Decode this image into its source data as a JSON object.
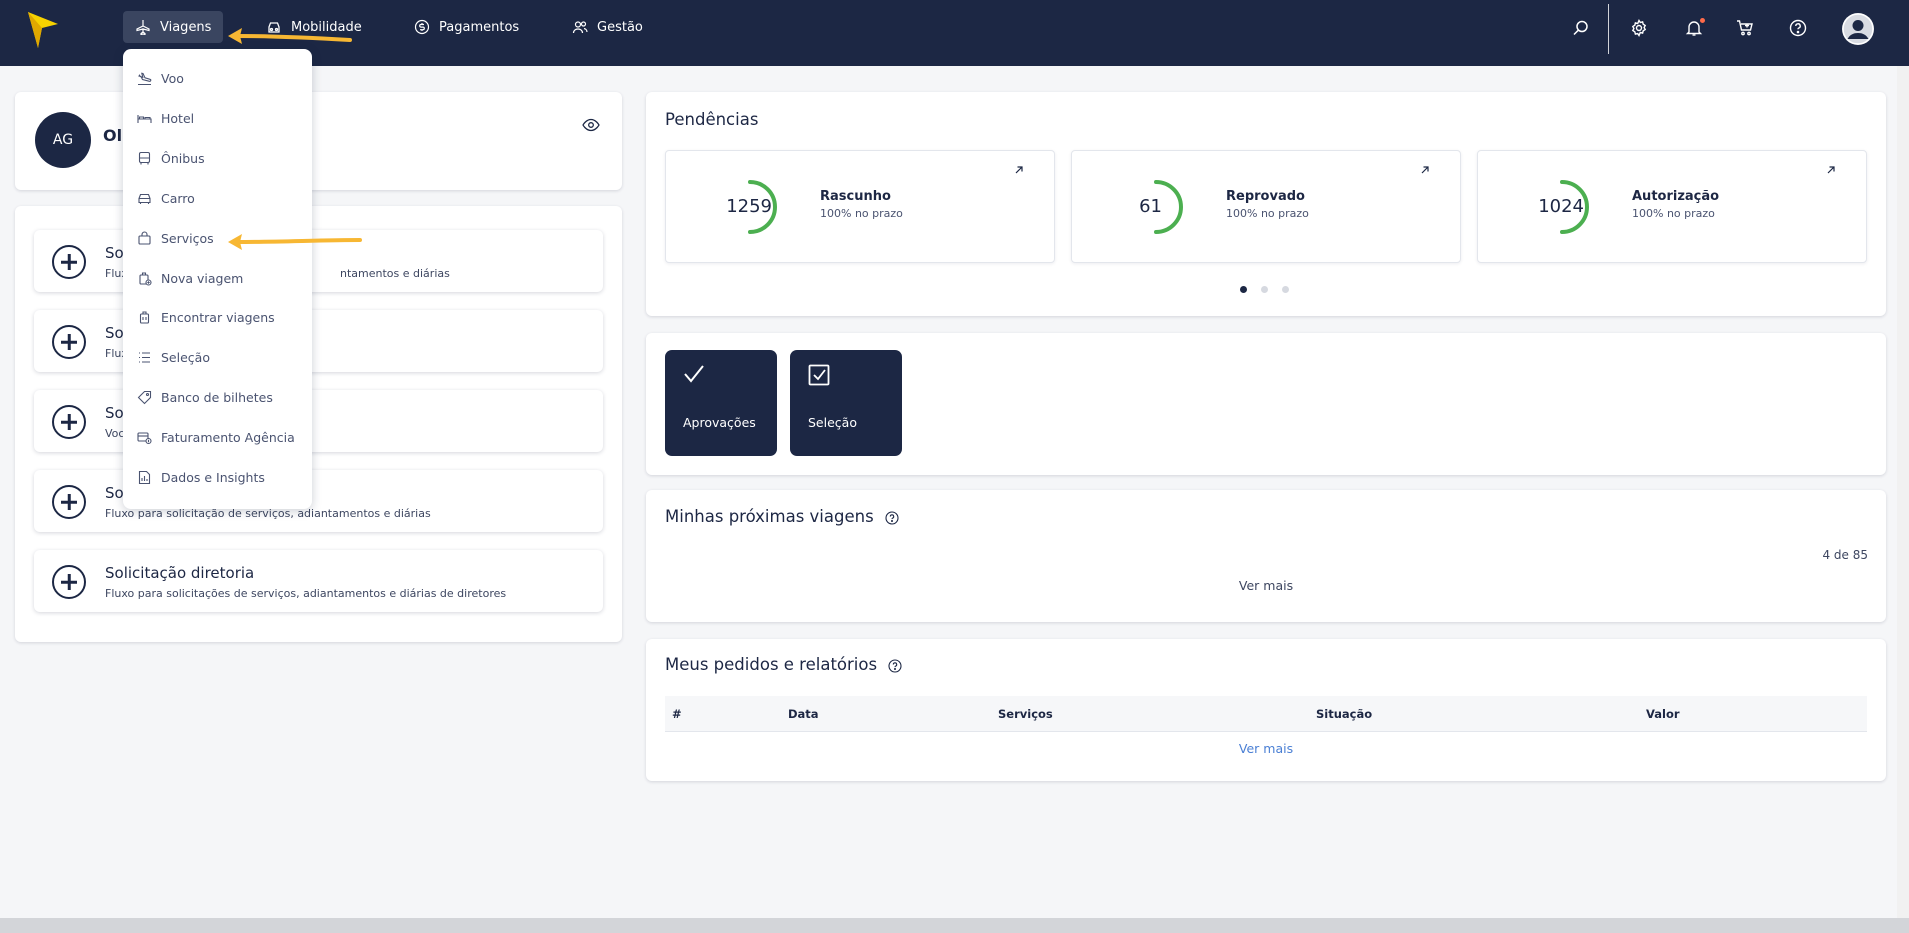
{
  "nav": {
    "items": [
      {
        "label": "Viagens",
        "icon": "plane-icon",
        "active": true
      },
      {
        "label": "Mobilidade",
        "icon": "car-icon"
      },
      {
        "label": "Pagamentos",
        "icon": "dollar-icon"
      },
      {
        "label": "Gestão",
        "icon": "users-icon"
      }
    ],
    "right_icons": [
      "search-icon",
      "gear-icon",
      "bell-icon",
      "cart-icon",
      "help-icon",
      "user-avatar"
    ]
  },
  "dropdown": {
    "items": [
      {
        "label": "Voo",
        "icon": "plane-landing-icon"
      },
      {
        "label": "Hotel",
        "icon": "bed-icon"
      },
      {
        "label": "Ônibus",
        "icon": "bus-icon"
      },
      {
        "label": "Carro",
        "icon": "car-icon"
      },
      {
        "label": "Serviços",
        "icon": "bag-icon"
      },
      {
        "label": "Nova viagem",
        "icon": "luggage-plus-icon"
      },
      {
        "label": "Encontrar viagens",
        "icon": "luggage-icon"
      },
      {
        "label": "Seleção",
        "icon": "list-icon"
      },
      {
        "label": "Banco de bilhetes",
        "icon": "ticket-icon"
      },
      {
        "label": "Faturamento Agência",
        "icon": "invoice-icon"
      },
      {
        "label": "Dados e Insights",
        "icon": "report-icon"
      }
    ]
  },
  "profile": {
    "initials": "AG",
    "greeting": "Ol"
  },
  "requests": [
    {
      "title": "So",
      "desc_left": "Flux",
      "desc_right": "ntamentos e diárias"
    },
    {
      "title": "So",
      "desc_left": "Flux",
      "desc_right": ""
    },
    {
      "title": "So",
      "desc_left": "Voc",
      "desc_right": ""
    },
    {
      "title": "So",
      "desc_left": "Fluxo para solicitação de serviços, adiantamentos e diárias",
      "desc_right": ""
    },
    {
      "title": "Solicitação diretoria",
      "desc_left": "Fluxo para solicitações de serviços, adiantamentos e diárias de diretores",
      "desc_right": ""
    }
  ],
  "pendencias": {
    "title": "Pendências",
    "cards": [
      {
        "value": "1259",
        "label": "Rascunho",
        "sub": "100% no prazo"
      },
      {
        "value": "61",
        "label": "Reprovado",
        "sub": "100% no prazo"
      },
      {
        "value": "1024",
        "label": "Autorização",
        "sub": "100% no prazo"
      }
    ]
  },
  "actions": [
    {
      "label": "Aprovações",
      "icon": "check-icon"
    },
    {
      "label": "Seleção",
      "icon": "checkbox-icon"
    }
  ],
  "trips": {
    "title": "Minhas próximas viagens",
    "count": "4 de 85",
    "ver_mais": "Ver mais"
  },
  "orders": {
    "title": "Meus pedidos e relatórios",
    "columns": [
      "#",
      "Data",
      "Serviços",
      "Situação",
      "Valor"
    ],
    "ver_mais": "Ver mais"
  },
  "colors": {
    "navy": "#1c2744",
    "ring_green": "#4caf50",
    "arrow_yellow": "#f7b733",
    "link_blue": "#4a7fd4"
  }
}
